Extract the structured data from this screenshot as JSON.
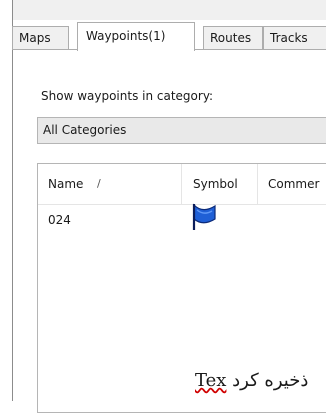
{
  "tabs": [
    {
      "label": "Maps"
    },
    {
      "label": "Waypoints(1)"
    },
    {
      "label": "Routes"
    },
    {
      "label": "Tracks"
    }
  ],
  "panel": {
    "category_label": "Show waypoints in category:",
    "category_value": "All Categories"
  },
  "table": {
    "columns": [
      {
        "label": "Name"
      },
      {
        "label": "Symbol"
      },
      {
        "label": "Commer"
      }
    ],
    "sort_indicator": "/",
    "rows": [
      {
        "name": "024",
        "symbol": "blue-flag-icon"
      }
    ]
  },
  "overlay": {
    "arabic": "ذخیره کرد",
    "latin": "Tex"
  },
  "colors": {
    "flag": "#1f5fd6",
    "flag_pole": "#0b1e5a"
  }
}
